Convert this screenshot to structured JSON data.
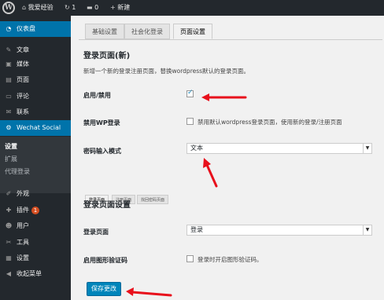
{
  "adminbar": {
    "site_name": "我爱经验",
    "updates": "1",
    "comments": "0",
    "new_label": "新建"
  },
  "sidebar": {
    "items": [
      {
        "label": "仪表盘",
        "icon": "dashboard-icon"
      },
      {
        "label": "文章",
        "icon": "pin-icon"
      },
      {
        "label": "媒体",
        "icon": "media-icon"
      },
      {
        "label": "页面",
        "icon": "page-icon"
      },
      {
        "label": "评论",
        "icon": "comment-icon"
      },
      {
        "label": "联系",
        "icon": "mail-icon"
      },
      {
        "label": "Wechat Social",
        "icon": "wechat-icon"
      }
    ],
    "submenu": [
      "设置",
      "扩展",
      "代理登录"
    ],
    "lower_items": [
      {
        "label": "外观",
        "icon": "brush-icon"
      },
      {
        "label": "插件",
        "icon": "plugin-icon",
        "badge": "1"
      },
      {
        "label": "用户",
        "icon": "user-icon"
      },
      {
        "label": "工具",
        "icon": "wrench-icon"
      },
      {
        "label": "设置",
        "icon": "settings-icon"
      },
      {
        "label": "收起菜单",
        "icon": "collapse-icon"
      }
    ]
  },
  "tabs": [
    "基础设置",
    "社会化登录",
    "页面设置"
  ],
  "section1": {
    "title": "登录页面(新)",
    "description": "新增一个新的登录注册页面，替换wordpress默认的登录页面。"
  },
  "fields": {
    "enable_label": "启用/禁用",
    "disable_wp_label": "禁用WP登录",
    "disable_wp_text": "禁用默认wordpress登录页面，使用新的登录/注册页面",
    "password_mode_label": "密码输入模式",
    "password_mode_value": "文本"
  },
  "subtabs": [
    "登录页面",
    "注册页面",
    "找回密码页面"
  ],
  "section2": {
    "title": "登录页面设置",
    "login_page_label": "登录页面",
    "login_page_value": "登录",
    "captcha_label": "启用图形验证码",
    "captcha_text": "登录时开启图形验证码。"
  },
  "save_button": "保存更改",
  "colors": {
    "accent": "#0073aa",
    "arrow": "#e8101c",
    "bar": "#23282d"
  }
}
